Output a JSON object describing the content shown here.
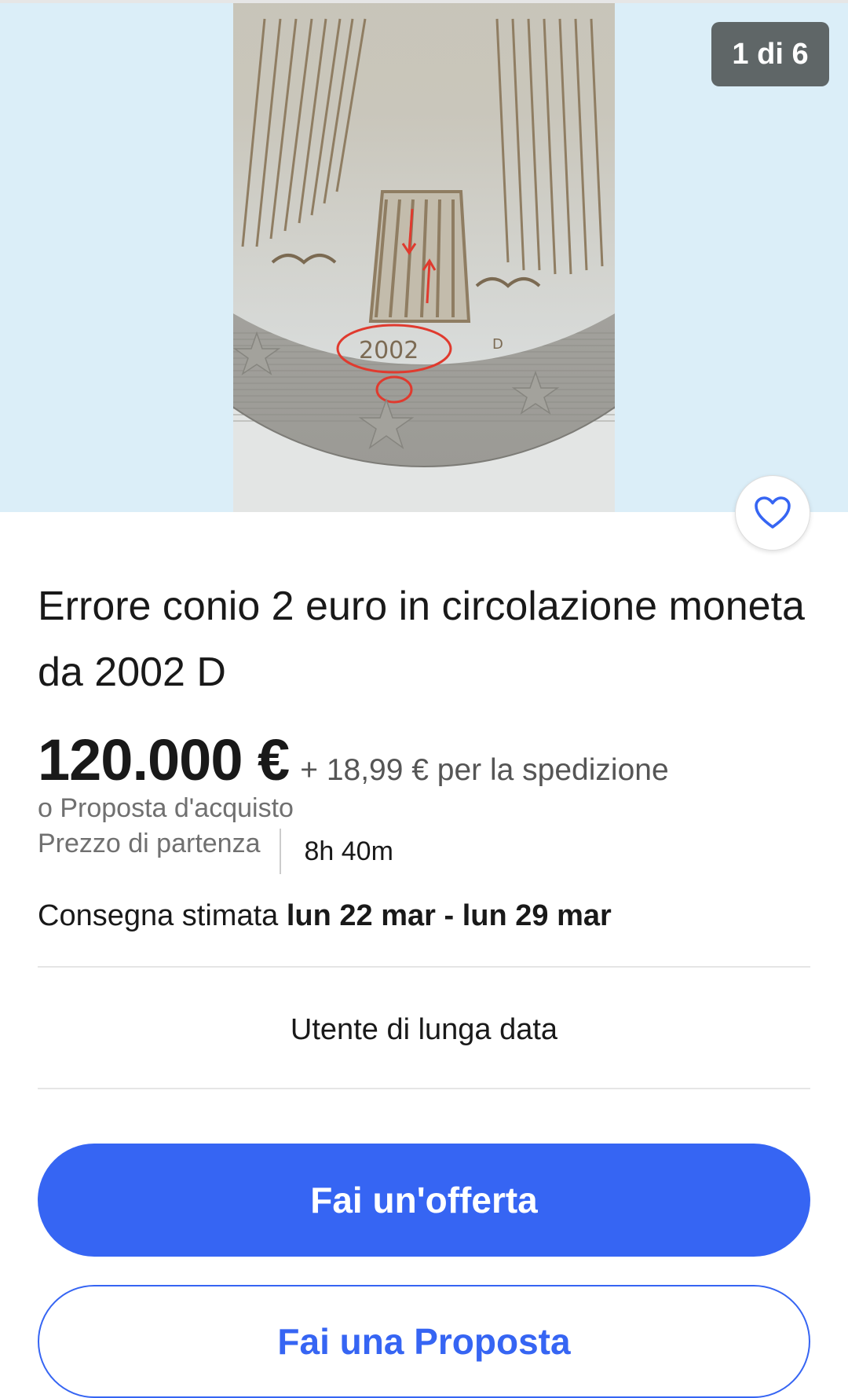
{
  "gallery": {
    "counter": "1 di 6",
    "coin_year_text": "2002",
    "coin_mint_mark": "D"
  },
  "listing": {
    "title": "Errore conio 2 euro in circolazione moneta da 2002 D",
    "price": "120.000 €",
    "shipping": "+ 18,99 € per la spedizione",
    "best_offer": "o Proposta d'acquisto",
    "format": "Prezzo di partenza",
    "time_left": "8h 40m",
    "delivery_label": "Consegna stimata",
    "delivery_dates": "lun 22 mar - lun 29 mar"
  },
  "seller": {
    "badge": "Utente di lunga data"
  },
  "actions": {
    "primary_label": "Fai un'offerta",
    "secondary_label": "Fai una Proposta"
  },
  "colors": {
    "accent": "#3665f3",
    "gallery_bg": "#dbeef8"
  },
  "icons": {
    "favorite": "heart-outline-icon"
  }
}
